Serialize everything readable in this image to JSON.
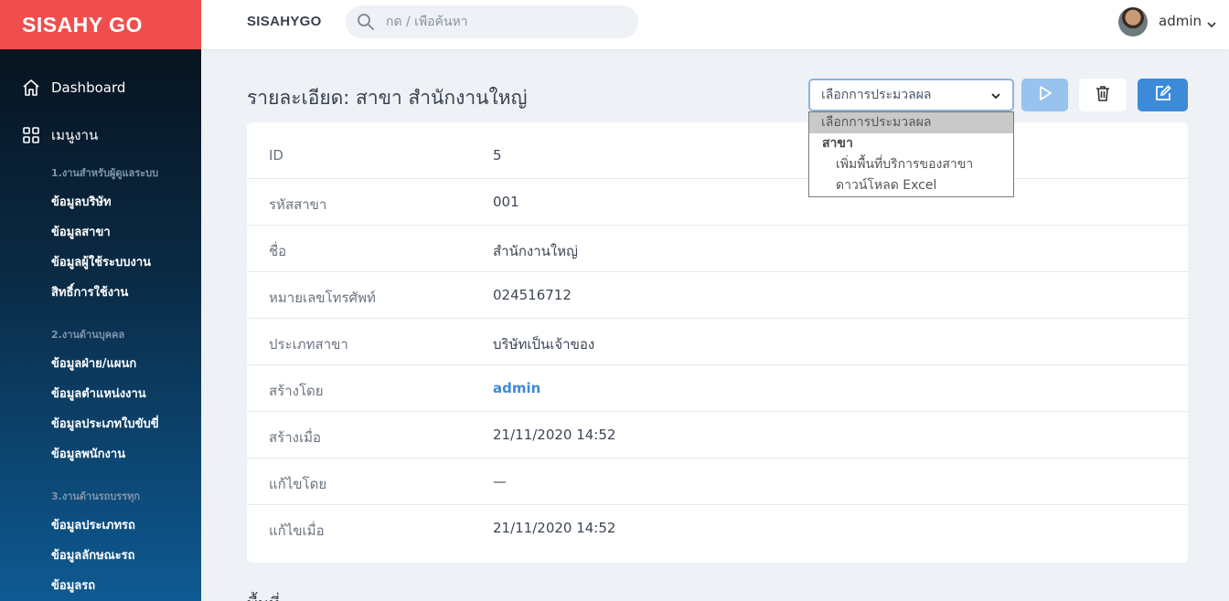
{
  "brand": "SISAHY GO",
  "sidebar": {
    "dashboard_label": "Dashboard",
    "menu_label": "เมนูงาน",
    "sections": [
      {
        "title": "1.งานสำหรับผู้ดูแลระบบ",
        "items": [
          "ข้อมูลบริษัท",
          "ข้อมูลสาขา",
          "ข้อมูลผู้ใช้ระบบงาน",
          "สิทธิ์การใช้งาน"
        ]
      },
      {
        "title": "2.งานด้านบุคคล",
        "items": [
          "ข้อมูลฝ่าย/แผนก",
          "ข้อมูลตำแหน่งงาน",
          "ข้อมูลประเภทใบขับขี่",
          "ข้อมูลพนักงาน"
        ]
      },
      {
        "title": "3.งานด้านรถบรรทุก",
        "items": [
          "ข้อมูลประเภทรถ",
          "ข้อมูลลักษณะรถ",
          "ข้อมูลรถ"
        ]
      }
    ]
  },
  "header": {
    "title": "SISAHYGO",
    "search_placeholder": "กด / เพื่อค้นหา",
    "user": "admin"
  },
  "page": {
    "title": "รายละเอียด: สาขา สำนักงานใหญ่",
    "select_value": "เลือกการประมวลผล",
    "dropdown": {
      "placeholder": "เลือกการประมวลผล",
      "group": "สาขา",
      "options": [
        "เพิ่มพื้นที่บริการของสาขา",
        "ดาวน์โหลด Excel"
      ]
    },
    "bottom_peek": "พื้นที่"
  },
  "details": [
    {
      "label": "ID",
      "value": "5"
    },
    {
      "label": "รหัสสาขา",
      "value": "001"
    },
    {
      "label": "ชื่อ",
      "value": "สำนักงานใหญ่"
    },
    {
      "label": "หมายเลขโทรศัพท์",
      "value": "024516712"
    },
    {
      "label": "ประเภทสาขา",
      "value": "บริษัทเป็นเจ้าของ"
    },
    {
      "label": "สร้างโดย",
      "value": "admin"
    },
    {
      "label": "สร้างเมื่อ",
      "value": "21/11/2020 14:52"
    },
    {
      "label": "แก้ไขโดย",
      "value": "—"
    },
    {
      "label": "แก้ไขเมื่อ",
      "value": "21/11/2020 14:52"
    }
  ],
  "colors": {
    "brand": "#f04e4e",
    "primary": "#3d8bd8",
    "run_button": "#97c3ee"
  },
  "icons": {
    "dashboard": "home-icon",
    "menu": "grid-icon",
    "search": "search-icon",
    "run": "play-icon",
    "delete": "trash-icon",
    "edit": "edit-icon"
  }
}
